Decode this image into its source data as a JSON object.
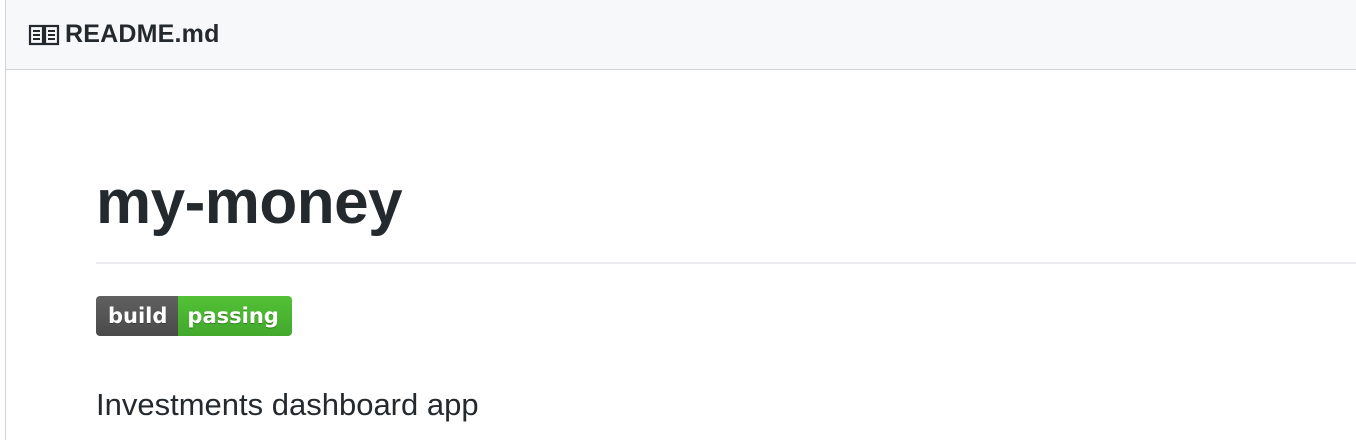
{
  "readme": {
    "filename": "README.md",
    "icon": "book-icon"
  },
  "main": {
    "title": "my-money",
    "badge": {
      "label": "build",
      "status": "passing",
      "label_color": "#555555",
      "status_color": "#4c1"
    },
    "description": "Investments dashboard app"
  }
}
